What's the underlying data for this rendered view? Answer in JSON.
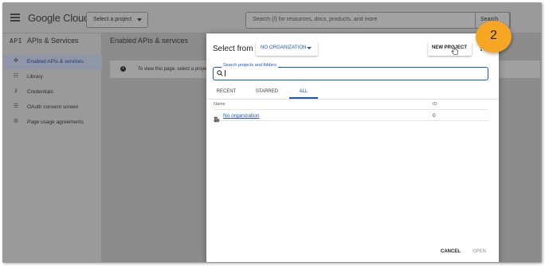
{
  "topbar": {
    "logo_text": "Google Cloud",
    "project_button_label": "Select a project",
    "search_placeholder": "Search (/) for resources, docs, products, and more",
    "search_button_label": "Search"
  },
  "sidebar": {
    "title_prefix": "API",
    "title": "APIs & Services",
    "items": [
      {
        "label": "Enabled APIs & services",
        "icon": "diamond-icon",
        "active": true
      },
      {
        "label": "Library",
        "icon": "library-icon",
        "active": false
      },
      {
        "label": "Credentials",
        "icon": "key-icon",
        "active": false
      },
      {
        "label": "OAuth consent screen",
        "icon": "consent-icon",
        "active": false
      },
      {
        "label": "Page usage agreements",
        "icon": "settings-icon",
        "active": false
      }
    ]
  },
  "main": {
    "title": "Enabled APIs & services",
    "info_text": "To view this page, select a project."
  },
  "dialog": {
    "title": "Select from",
    "org_select_label": "NO ORGANIZATION",
    "new_project_label": "NEW PROJECT",
    "search_label": "Search projects and folders",
    "search_value": "",
    "tabs": [
      {
        "label": "RECENT",
        "active": false
      },
      {
        "label": "STARRED",
        "active": false
      },
      {
        "label": "ALL",
        "active": true
      }
    ],
    "columns": {
      "name": "Name",
      "id": "ID"
    },
    "rows": [
      {
        "name": "No organization",
        "id": "0"
      }
    ],
    "cancel_label": "CANCEL",
    "open_label": "OPEN"
  },
  "annotation": {
    "step_number": "2",
    "color": "#f6a623"
  },
  "colors": {
    "accent": "#1a56c4"
  }
}
